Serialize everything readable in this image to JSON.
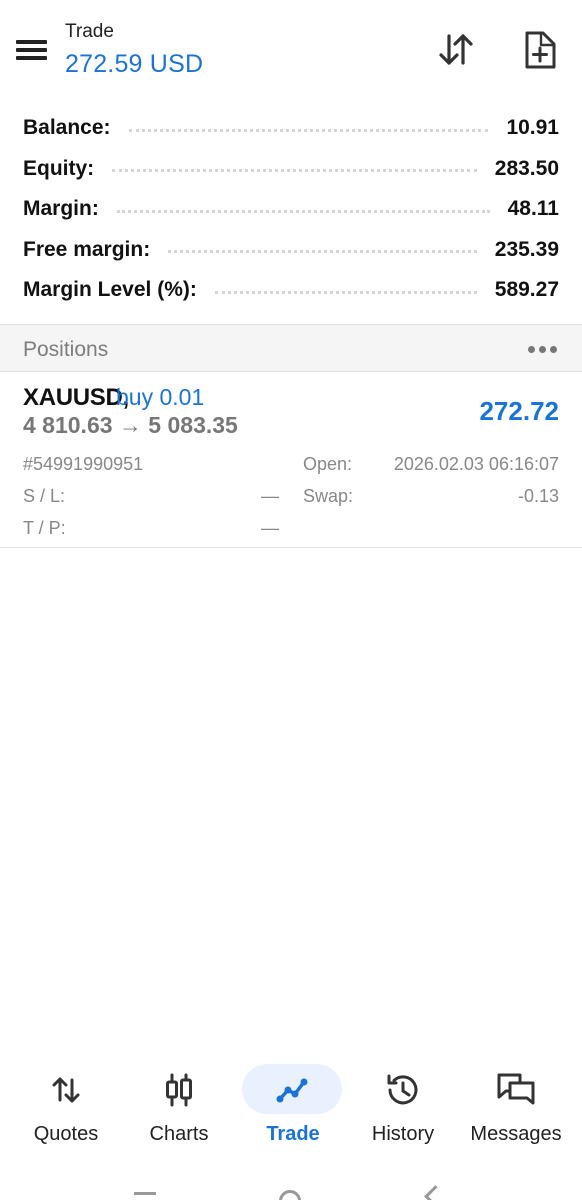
{
  "header": {
    "title": "Trade",
    "subtitle": "272.59 USD",
    "icons": [
      "menu-icon",
      "sort-icon",
      "new-order-icon"
    ]
  },
  "summary": [
    {
      "label": "Balance:",
      "value": "10.91"
    },
    {
      "label": "Equity:",
      "value": "283.50"
    },
    {
      "label": "Margin:",
      "value": "48.11"
    },
    {
      "label": "Free margin:",
      "value": "235.39"
    },
    {
      "label": "Margin Level (%):",
      "value": "589.27"
    }
  ],
  "positions": {
    "title": "Positions",
    "items": [
      {
        "symbol": "XAUUSD,",
        "side": "buy 0.01",
        "prices": "4 810.63 → 5 083.35",
        "profit": "272.72",
        "ticket": "#54991990951",
        "open_label": "Open:",
        "open_value": "2026.02.03 06:16:07",
        "sl_label": "S / L:",
        "sl_value": "—",
        "swap_label": "Swap:",
        "swap_value": "-0.13",
        "tp_label": "T / P:",
        "tp_value": "—"
      }
    ]
  },
  "nav": {
    "active": "Trade",
    "items": [
      {
        "label": "Quotes",
        "icon": "quotes-icon"
      },
      {
        "label": "Charts",
        "icon": "charts-icon"
      },
      {
        "label": "Trade",
        "icon": "trade-icon"
      },
      {
        "label": "History",
        "icon": "history-icon"
      },
      {
        "label": "Messages",
        "icon": "messages-icon"
      }
    ]
  },
  "colors": {
    "accent": "#1a73d6",
    "active_pill": "#e8f1fd",
    "section_bg": "#f5f5f5"
  }
}
